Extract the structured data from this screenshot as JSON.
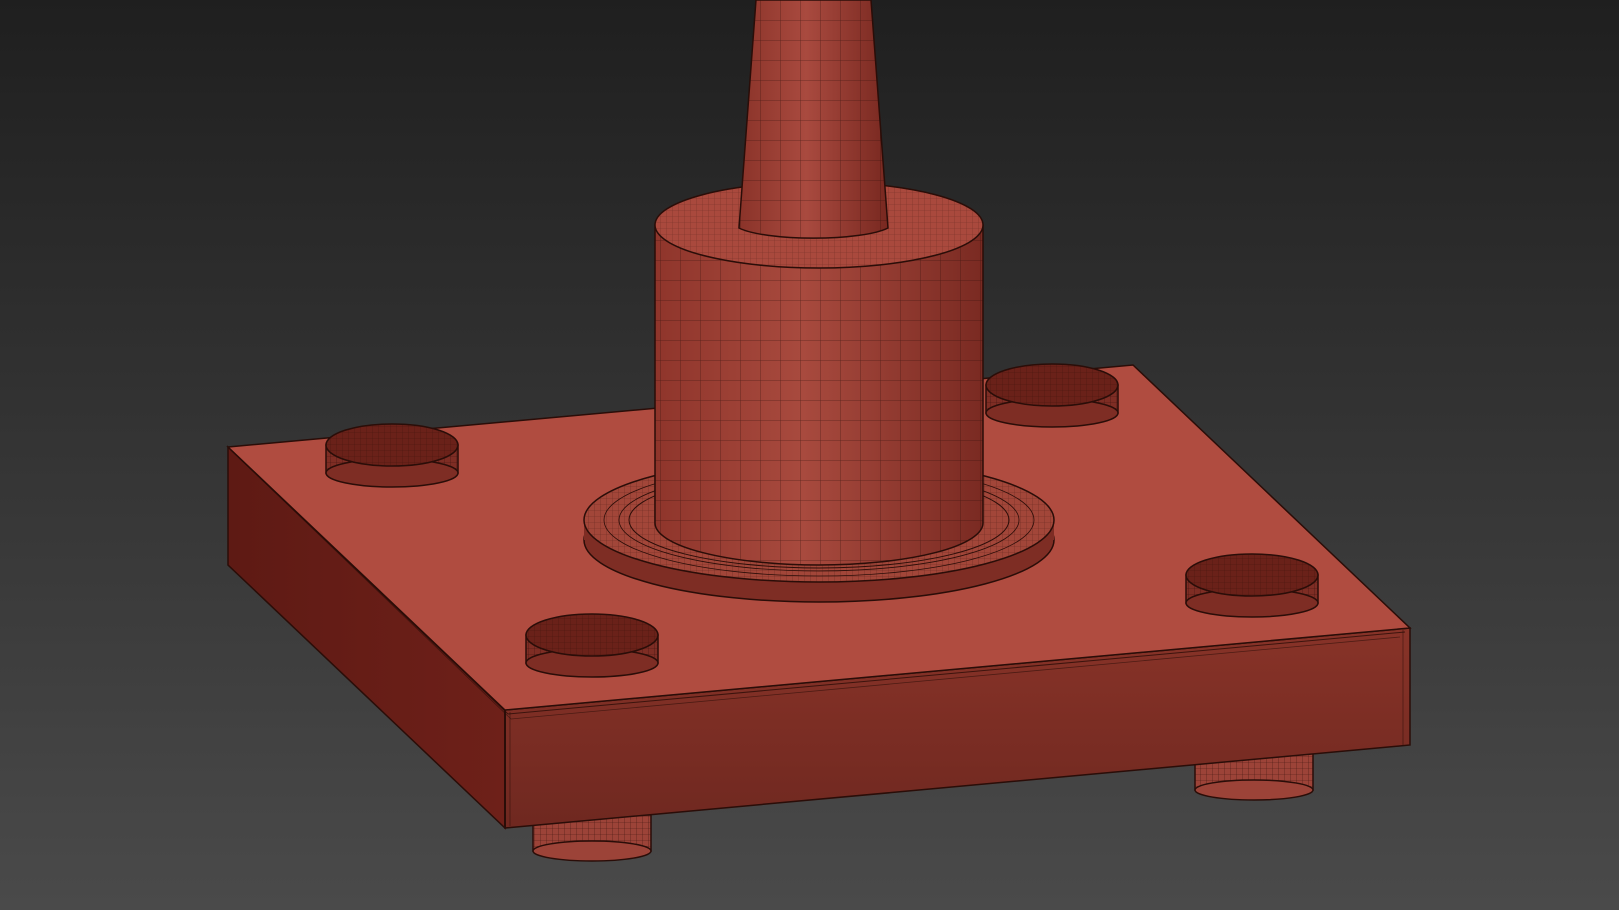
{
  "viewport": {
    "background_top": "#1f1f1f",
    "background_bottom": "#4a4a4a",
    "display_mode": "shaded-wireframe"
  },
  "model": {
    "base_color": "#a84a3e",
    "face_light": "#b14d40",
    "face_side": "#8a3428",
    "face_dark": "#6b1f18",
    "edge_color": "#2a0d08",
    "parts": [
      "base-plate",
      "flange-washer",
      "column",
      "tapered-pole",
      "bolt-head",
      "bolt-foot"
    ]
  }
}
